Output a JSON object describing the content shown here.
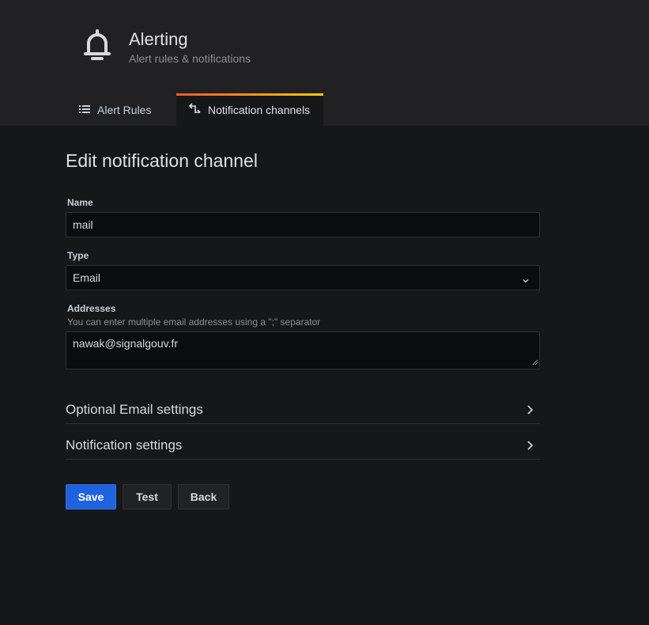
{
  "header": {
    "title": "Alerting",
    "subtitle": "Alert rules & notifications",
    "icon": "bell-icon"
  },
  "tabs": [
    {
      "label": "Alert Rules",
      "icon": "list-icon",
      "active": false
    },
    {
      "label": "Notification channels",
      "icon": "channel-icon",
      "active": true
    }
  ],
  "form": {
    "title": "Edit notification channel",
    "name": {
      "label": "Name",
      "value": "mail"
    },
    "type": {
      "label": "Type",
      "value": "Email"
    },
    "addresses": {
      "label": "Addresses",
      "description": "You can enter multiple email addresses using a \";\" separator",
      "value": "nawak@signalgouv.fr"
    },
    "sections": [
      {
        "label": "Optional Email settings"
      },
      {
        "label": "Notification settings"
      }
    ]
  },
  "buttons": {
    "save": "Save",
    "test": "Test",
    "back": "Back"
  },
  "colors": {
    "primary": "#1f62e0",
    "tab_accent_start": "#f05a28",
    "tab_accent_end": "#fbca0a",
    "background": "#161719",
    "header_background": "#212124"
  }
}
